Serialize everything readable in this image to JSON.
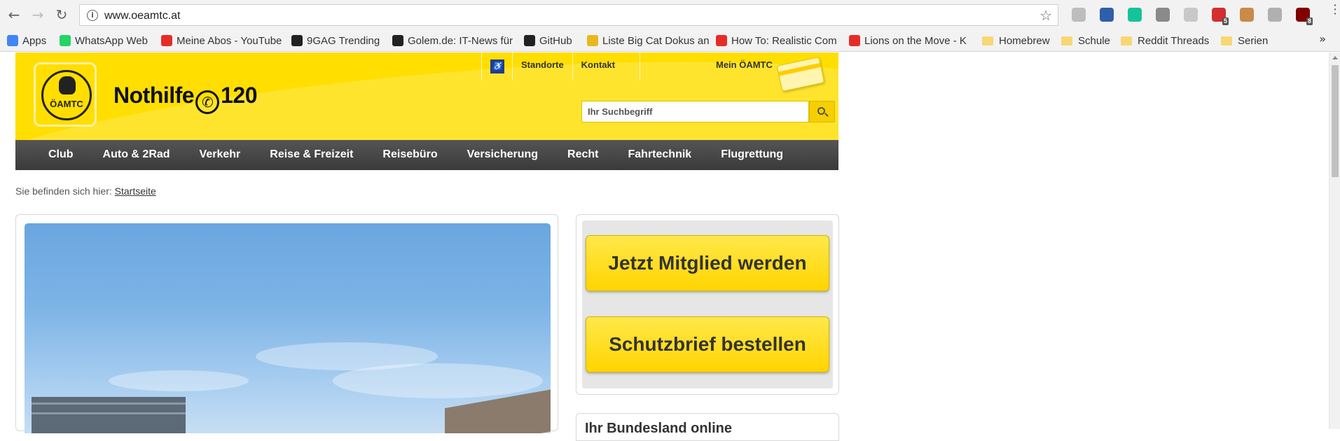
{
  "browser": {
    "url": "www.oeamtc.at",
    "extensions": [
      {
        "name": "play-extension-icon",
        "color": "#bdbdbd",
        "badge": ""
      },
      {
        "name": "mail-extension-icon",
        "color": "#2f5fa8",
        "badge": ""
      },
      {
        "name": "grammarly-icon",
        "color": "#15c39a",
        "badge": ""
      },
      {
        "name": "sofa-extension-icon",
        "color": "#8a8a8a",
        "badge": ""
      },
      {
        "name": "cube-extension-icon",
        "color": "#c8c8c8",
        "badge": ""
      },
      {
        "name": "adblock-plus-icon",
        "color": "#d32f2f",
        "badge": "5"
      },
      {
        "name": "face-extension-icon",
        "color": "#c98a4a",
        "badge": ""
      },
      {
        "name": "cup-extension-icon",
        "color": "#b0b0b0",
        "badge": ""
      },
      {
        "name": "ublock-icon",
        "color": "#800000",
        "badge": "8"
      }
    ]
  },
  "bookmarks": [
    {
      "label": "Apps",
      "icon": "apps-icon",
      "color": "#4285f4"
    },
    {
      "label": "WhatsApp Web",
      "icon": "whatsapp-icon",
      "color": "#25d366"
    },
    {
      "label": "Meine Abos - YouTube",
      "icon": "youtube-icon",
      "color": "#e52d27"
    },
    {
      "label": "9GAG Trending",
      "icon": "9gag-icon",
      "color": "#222222"
    },
    {
      "label": "Golem.de: IT-News für",
      "icon": "golem-icon",
      "color": "#222222"
    },
    {
      "label": "GitHub",
      "icon": "github-icon",
      "color": "#222222"
    },
    {
      "label": "Liste Big Cat Dokus an",
      "icon": "imdb-icon",
      "color": "#e6b91e"
    },
    {
      "label": "How To: Realistic Com",
      "icon": "youtube-icon",
      "color": "#e52d27"
    },
    {
      "label": "Lions on the Move - K",
      "icon": "youtube-icon",
      "color": "#e52d27"
    },
    {
      "label": "Homebrew",
      "icon": "folder-icon",
      "color": "#f7d774"
    },
    {
      "label": "Schule",
      "icon": "folder-icon",
      "color": "#f7d774"
    },
    {
      "label": "Reddit Threads",
      "icon": "folder-icon",
      "color": "#f7d774"
    },
    {
      "label": "Serien",
      "icon": "folder-icon",
      "color": "#f7d774"
    }
  ],
  "header": {
    "logo_text": "ÖAMTC",
    "hotline_prefix": "Nothilfe",
    "hotline_number": "120",
    "top_links": [
      "Standorte",
      "Kontakt"
    ],
    "member_link": "Mein ÖAMTC",
    "search_placeholder": "Ihr Suchbegriff"
  },
  "main_nav": [
    "Club",
    "Auto & 2Rad",
    "Verkehr",
    "Reise & Freizeit",
    "Reisebüro",
    "Versicherung",
    "Recht",
    "Fahrtechnik",
    "Flugrettung"
  ],
  "breadcrumb": {
    "prefix": "Sie befinden sich hier:",
    "link": "Startseite"
  },
  "sidebar": {
    "cta_primary": "Jetzt Mitglied werden",
    "cta_secondary": "Schutzbrief bestellen",
    "next_box_title": "Ihr Bundesland online"
  },
  "colors": {
    "brand_yellow": "#ffde00",
    "nav_dark": "#3a3a3a"
  }
}
